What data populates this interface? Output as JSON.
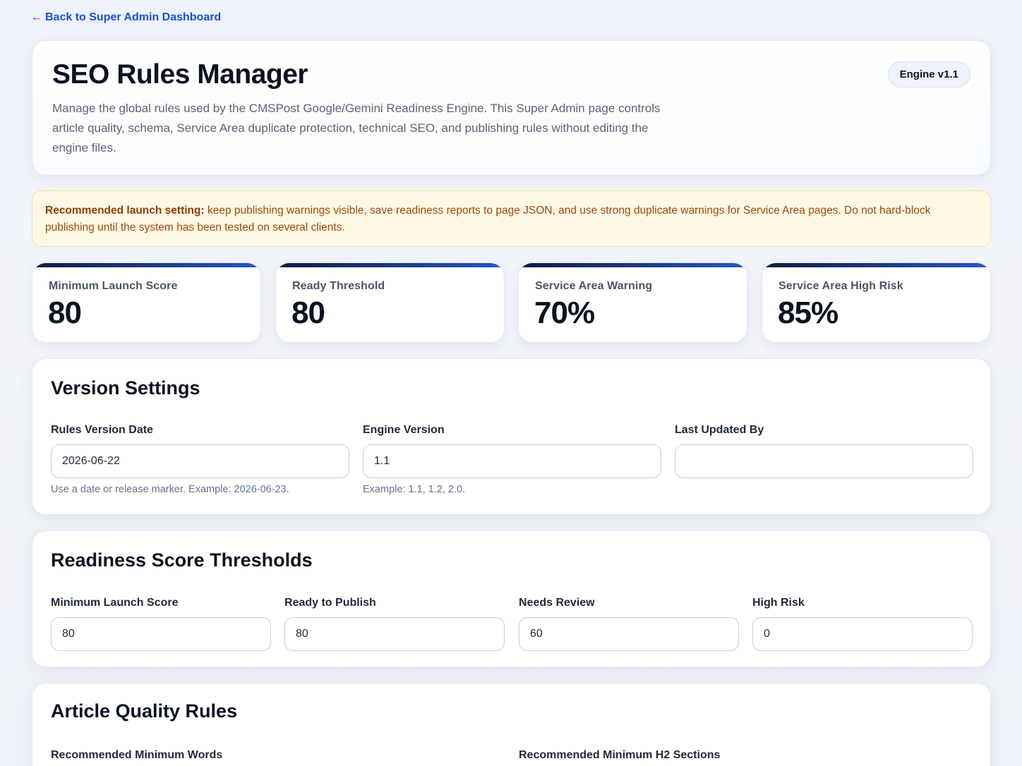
{
  "nav": {
    "back_arrow": "←",
    "back_label": "Back to Super Admin Dashboard"
  },
  "header": {
    "title": "SEO Rules Manager",
    "description": "Manage the global rules used by the CMSPost Google/Gemini Readiness Engine. This Super Admin page controls article quality, schema, Service Area duplicate protection, technical SEO, and publishing rules without editing the engine files.",
    "engine_badge": "Engine v1.1"
  },
  "notice": {
    "lead": "Recommended launch setting:",
    "text": " keep publishing warnings visible, save readiness reports to page JSON, and use strong duplicate warnings for Service Area pages. Do not hard-block publishing until the system has been tested on several clients."
  },
  "stats": [
    {
      "label": "Minimum Launch Score",
      "value": "80"
    },
    {
      "label": "Ready Threshold",
      "value": "80"
    },
    {
      "label": "Service Area Warning",
      "value": "70%"
    },
    {
      "label": "Service Area High Risk",
      "value": "85%"
    }
  ],
  "version_settings": {
    "title": "Version Settings",
    "fields": [
      {
        "label": "Rules Version Date",
        "value": "2026-06-22",
        "hint": "Use a date or release marker. Example: 2026-06-23."
      },
      {
        "label": "Engine Version",
        "value": "1.1",
        "hint": "Example: 1.1, 1.2, 2.0."
      },
      {
        "label": "Last Updated By",
        "value": "",
        "hint": ""
      }
    ]
  },
  "thresholds": {
    "title": "Readiness Score Thresholds",
    "fields": [
      {
        "label": "Minimum Launch Score",
        "value": "80"
      },
      {
        "label": "Ready to Publish",
        "value": "80"
      },
      {
        "label": "Needs Review",
        "value": "60"
      },
      {
        "label": "High Risk",
        "value": "0"
      }
    ]
  },
  "article_quality": {
    "title": "Article Quality Rules",
    "fields": [
      {
        "label": "Recommended Minimum Words"
      },
      {
        "label": "Recommended Minimum H2 Sections"
      }
    ]
  },
  "colors": {
    "accent": "#1d4ed8",
    "notice_bg": "#fff8e4",
    "notice_text": "#9a4a0f",
    "stat_bar": "#1f3f8a"
  }
}
